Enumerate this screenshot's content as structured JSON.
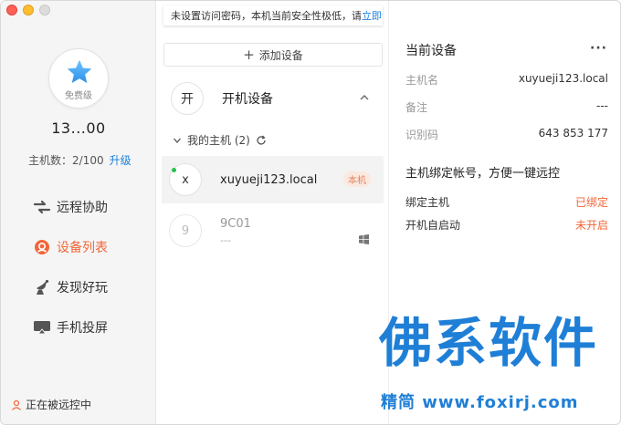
{
  "notice": {
    "text": "未设置访问密码，本机当前安全性极低，请",
    "link": "立即设置"
  },
  "sidebar": {
    "tier": "免费级",
    "uid": "13...00",
    "host_count_label": "主机数：2/100",
    "upgrade": "升级",
    "nav": [
      {
        "label": "远程协助",
        "icon": "remote-assist-icon",
        "active": false
      },
      {
        "label": "设备列表",
        "icon": "device-list-icon",
        "active": true
      },
      {
        "label": "发现好玩",
        "icon": "discover-icon",
        "active": false
      },
      {
        "label": "手机投屏",
        "icon": "screen-cast-icon",
        "active": false
      }
    ],
    "footer": "正在被远控中"
  },
  "middle": {
    "add_device": "添加设备",
    "group": {
      "badge": "开",
      "title": "开机设备"
    },
    "subgroup": "我的主机 (2)",
    "devices": [
      {
        "badge": "x",
        "name": "xuyueji123.local",
        "tag": "本机",
        "online": true
      },
      {
        "badge": "9",
        "name": "9C01",
        "sub": "---",
        "os": "windows-icon"
      }
    ]
  },
  "right": {
    "title": "当前设备",
    "more": "···",
    "info": [
      {
        "key": "主机名",
        "value": "xuyueji123.local"
      },
      {
        "key": "备注",
        "value": "---"
      },
      {
        "key": "识别码",
        "value": "643 853 177"
      }
    ],
    "bind_title": "主机绑定帐号，方便一键远控",
    "bind_rows": [
      {
        "key": "绑定主机",
        "value": "已绑定"
      },
      {
        "key": "开机自启动",
        "value": "未开启"
      }
    ]
  },
  "watermark": {
    "title": "佛系软件",
    "sub": "精简 www.foxirj.com"
  },
  "colors": {
    "accent": "#f0673a",
    "link": "#1a7fe0",
    "online": "#27c24c",
    "watermark": "#1f7fd6"
  }
}
